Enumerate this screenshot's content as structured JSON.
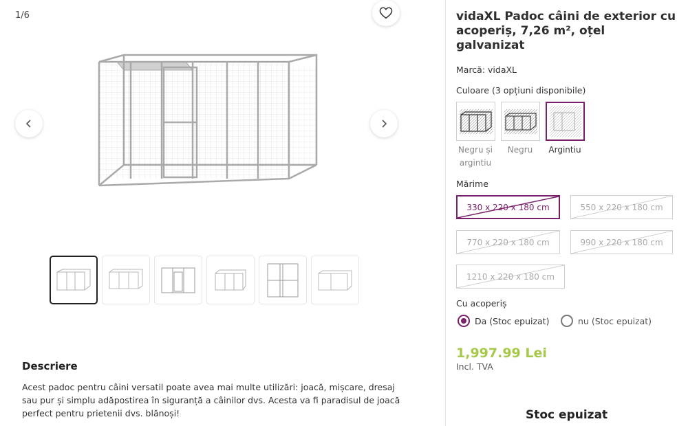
{
  "gallery": {
    "counter": "1/6",
    "thumbnail_count": 6
  },
  "product": {
    "title": "vidaXL Padoc câini de exterior cu acoperiș, 7,26 m², oțel galvanizat",
    "brand_text": "Marcă: vidaXL",
    "color_label": "Culoare (3 opțiuni disponibile)",
    "colors": [
      {
        "name": "Negru și argintiu",
        "selected": false
      },
      {
        "name": "Negru",
        "selected": false
      },
      {
        "name": "Argintiu",
        "selected": true
      }
    ],
    "size_label": "Mărime",
    "sizes": [
      {
        "label": "330 x 220 x 180 cm",
        "selected": true,
        "unavailable": true
      },
      {
        "label": "550 x 220 x 180 cm",
        "selected": false,
        "unavailable": true
      },
      {
        "label": "770 x 220 x 180 cm",
        "selected": false,
        "unavailable": true
      },
      {
        "label": "990 x 220 x 180 cm",
        "selected": false,
        "unavailable": true
      },
      {
        "label": "1210 x 220 x 180 cm",
        "selected": false,
        "unavailable": true
      }
    ],
    "roof_label": "Cu acoperiș",
    "roof_options": [
      {
        "label": "Da (Stoc epuizat)",
        "checked": true
      },
      {
        "label": "nu (Stoc epuizat)",
        "checked": false
      }
    ],
    "price": "1,997.99 Lei",
    "vat": "Incl. TVA",
    "stock_status": "Stoc epuizat"
  },
  "description": {
    "title": "Descriere",
    "text": "Acest padoc pentru câini versatil poate avea mai multe utilizări: joacă, mișcare, dresaj sau pur și simplu adăpostirea în siguranță a câinilor dvs. Acesta va fi paradisul de joacă perfect pentru prietenii dvs. blănoși!"
  },
  "colors": {
    "accent": "#7a1f6a",
    "price": "#a7c94a"
  },
  "icons": {
    "favorite": "heart-icon",
    "prev": "chevron-left-icon",
    "next": "chevron-right-icon"
  }
}
